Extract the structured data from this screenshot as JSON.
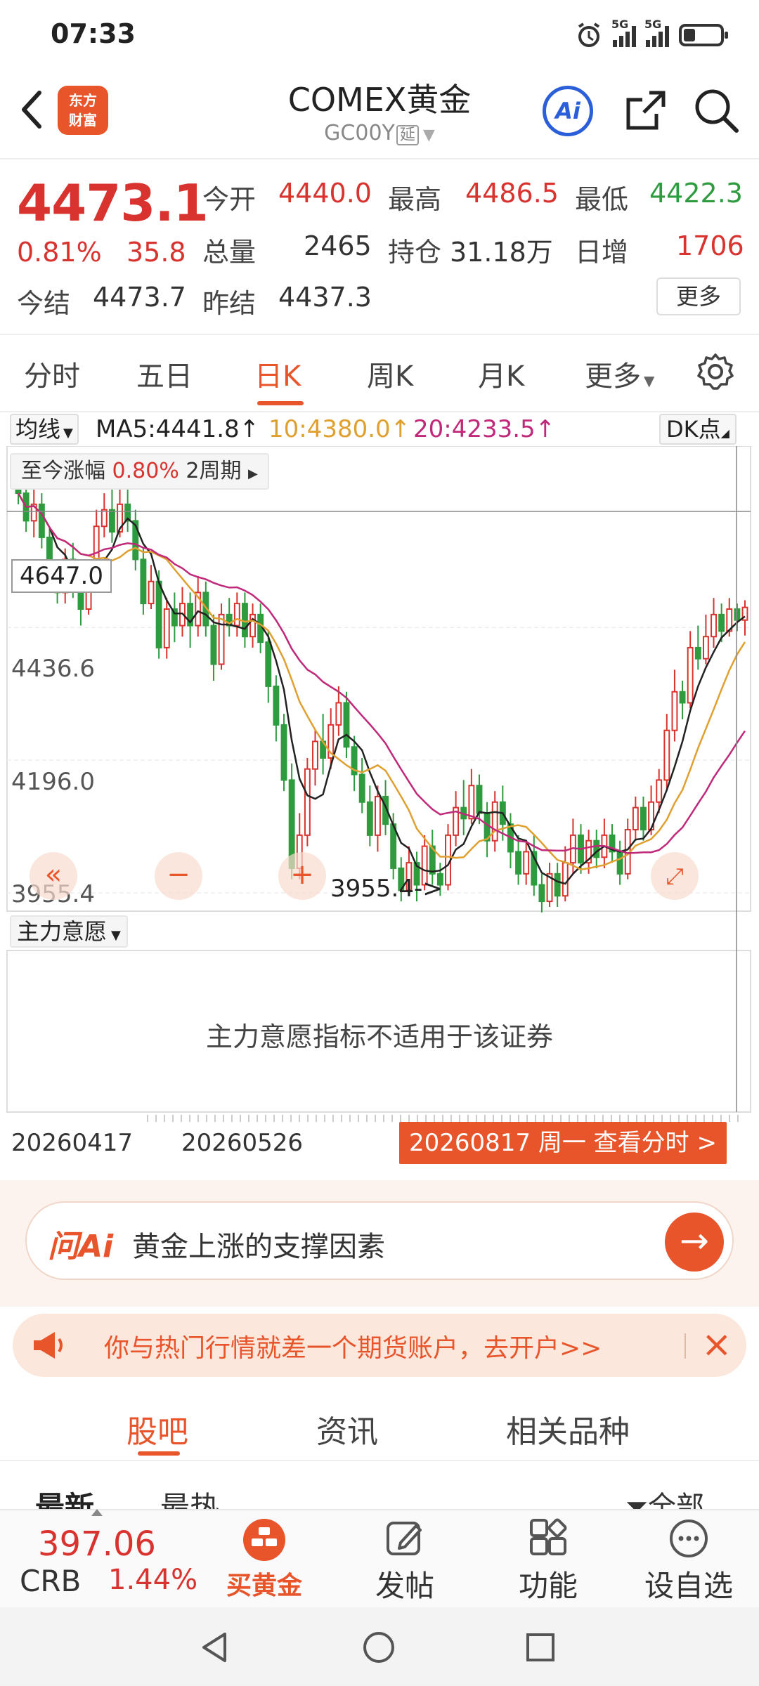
{
  "status_bar": {
    "time": "07:33",
    "sig1": "5G",
    "sig2": "5G"
  },
  "header": {
    "logo_line1": "东方",
    "logo_line2": "财富",
    "title": "COMEX黄金",
    "subtitle": "GC00Y",
    "delay_tag": "延",
    "ai_label": "Ai"
  },
  "quote": {
    "price": "4473.1",
    "change_pct": "0.81%",
    "change_val": "35.8",
    "open_label": "今开",
    "open": "4440.0",
    "high_label": "最高",
    "high": "4486.5",
    "low_label": "最低",
    "low": "4422.3",
    "volume_label": "总量",
    "volume": "2465",
    "oi_label": "持仓",
    "oi": "31.18万",
    "daily_inc_label": "日增",
    "daily_inc": "1706",
    "settle_label": "今结",
    "settle": "4473.7",
    "prev_settle_label": "昨结",
    "prev_settle": "4437.3",
    "more": "更多"
  },
  "period_tabs": [
    "分时",
    "五日",
    "日K",
    "周K",
    "月K",
    "更多"
  ],
  "active_period": "日K",
  "ma_row": {
    "select": "均线",
    "ma5": "MA5:4441.8↑",
    "ma10": "10:4380.0↑",
    "ma20": "20:4233.5↑",
    "dk": "DK点"
  },
  "colors": {
    "accent": "#e8552b",
    "up": "#d8332f",
    "down": "#2e9b3e",
    "ma5": "#222222",
    "ma10": "#e0a030",
    "ma20": "#c0287a"
  },
  "chart_data": {
    "type": "candlestick",
    "range_label": "至今涨幅",
    "range_pct": "0.80%",
    "range_period": "2周期",
    "cursor_value": "4647.0",
    "y_ticks": [
      "4436.6",
      "4196.0",
      "3955.4"
    ],
    "y_range": [
      3955.4,
      4740
    ],
    "min_label": "3955.4->",
    "x_ticks": [
      "20260417",
      "20260526"
    ],
    "selected_date": "20260817 周一 查看分时 >",
    "candles": [
      [
        4720,
        4680,
        4740,
        4660
      ],
      [
        4680,
        4630,
        4700,
        4610
      ],
      [
        4630,
        4660,
        4690,
        4600
      ],
      [
        4660,
        4600,
        4680,
        4580
      ],
      [
        4600,
        4520,
        4620,
        4500
      ],
      [
        4520,
        4500,
        4560,
        4480
      ],
      [
        4500,
        4560,
        4580,
        4480
      ],
      [
        4560,
        4510,
        4590,
        4490
      ],
      [
        4510,
        4470,
        4530,
        4440
      ],
      [
        4470,
        4540,
        4560,
        4460
      ],
      [
        4540,
        4620,
        4650,
        4530
      ],
      [
        4620,
        4650,
        4680,
        4600
      ],
      [
        4650,
        4610,
        4690,
        4590
      ],
      [
        4610,
        4660,
        4700,
        4600
      ],
      [
        4660,
        4630,
        4710,
        4610
      ],
      [
        4630,
        4560,
        4650,
        4540
      ],
      [
        4560,
        4480,
        4580,
        4460
      ],
      [
        4480,
        4520,
        4550,
        4470
      ],
      [
        4520,
        4400,
        4540,
        4380
      ],
      [
        4400,
        4470,
        4490,
        4380
      ],
      [
        4470,
        4440,
        4500,
        4410
      ],
      [
        4440,
        4480,
        4510,
        4420
      ],
      [
        4480,
        4440,
        4500,
        4400
      ],
      [
        4440,
        4500,
        4530,
        4420
      ],
      [
        4500,
        4440,
        4520,
        4420
      ],
      [
        4440,
        4370,
        4460,
        4340
      ],
      [
        4370,
        4460,
        4480,
        4360
      ],
      [
        4460,
        4440,
        4490,
        4420
      ],
      [
        4440,
        4480,
        4500,
        4420
      ],
      [
        4480,
        4420,
        4500,
        4400
      ],
      [
        4420,
        4460,
        4480,
        4400
      ],
      [
        4460,
        4410,
        4480,
        4390
      ],
      [
        4410,
        4330,
        4430,
        4300
      ],
      [
        4330,
        4260,
        4350,
        4230
      ],
      [
        4260,
        4160,
        4280,
        4140
      ],
      [
        4160,
        4000,
        4190,
        3980
      ],
      [
        4000,
        4060,
        4100,
        3980
      ],
      [
        4060,
        4180,
        4200,
        4040
      ],
      [
        4180,
        4230,
        4250,
        4150
      ],
      [
        4230,
        4200,
        4280,
        4170
      ],
      [
        4200,
        4260,
        4290,
        4180
      ],
      [
        4260,
        4300,
        4330,
        4240
      ],
      [
        4300,
        4220,
        4320,
        4200
      ],
      [
        4220,
        4170,
        4240,
        4140
      ],
      [
        4170,
        4120,
        4200,
        4100
      ],
      [
        4120,
        4060,
        4150,
        4040
      ],
      [
        4060,
        4130,
        4150,
        4030
      ],
      [
        4130,
        4080,
        4160,
        4060
      ],
      [
        4080,
        4000,
        4100,
        3980
      ],
      [
        4000,
        3960,
        4020,
        3940
      ],
      [
        3960,
        4010,
        4040,
        3950
      ],
      [
        4010,
        3970,
        4030,
        3940
      ],
      [
        3970,
        4040,
        4060,
        3960
      ],
      [
        4040,
        3990,
        4070,
        3970
      ],
      [
        3990,
        3970,
        4010,
        3950
      ],
      [
        3970,
        4060,
        4080,
        3960
      ],
      [
        4060,
        4110,
        4140,
        4040
      ],
      [
        4110,
        4090,
        4160,
        4060
      ],
      [
        4090,
        4150,
        4180,
        4080
      ],
      [
        4150,
        4100,
        4170,
        4080
      ],
      [
        4100,
        4050,
        4120,
        4020
      ],
      [
        4050,
        4120,
        4140,
        4030
      ],
      [
        4120,
        4080,
        4150,
        4050
      ],
      [
        4080,
        4030,
        4100,
        4000
      ],
      [
        4030,
        3990,
        4060,
        3970
      ],
      [
        3990,
        4030,
        4050,
        3970
      ],
      [
        4030,
        3970,
        4060,
        3950
      ],
      [
        3970,
        3940,
        3990,
        3920
      ],
      [
        3940,
        3990,
        4010,
        3930
      ],
      [
        3990,
        3950,
        4010,
        3930
      ],
      [
        3950,
        4010,
        4040,
        3940
      ],
      [
        4010,
        4060,
        4090,
        3990
      ],
      [
        4060,
        4010,
        4080,
        3990
      ],
      [
        4010,
        4050,
        4070,
        3990
      ],
      [
        4050,
        4020,
        4070,
        4000
      ],
      [
        4020,
        4060,
        4090,
        4000
      ],
      [
        4060,
        4030,
        4080,
        4010
      ],
      [
        4030,
        3990,
        4050,
        3970
      ],
      [
        3990,
        4070,
        4090,
        3980
      ],
      [
        4070,
        4110,
        4130,
        4050
      ],
      [
        4110,
        4070,
        4130,
        4050
      ],
      [
        4070,
        4120,
        4150,
        4060
      ],
      [
        4120,
        4160,
        4180,
        4100
      ],
      [
        4160,
        4250,
        4280,
        4140
      ],
      [
        4250,
        4320,
        4360,
        4230
      ],
      [
        4320,
        4300,
        4340,
        4270
      ],
      [
        4300,
        4400,
        4430,
        4290
      ],
      [
        4400,
        4380,
        4440,
        4360
      ],
      [
        4380,
        4420,
        4460,
        4370
      ],
      [
        4420,
        4460,
        4490,
        4400
      ],
      [
        4460,
        4430,
        4480,
        4410
      ],
      [
        4430,
        4470,
        4490,
        4420
      ],
      [
        4470,
        4450,
        4480,
        4430
      ],
      [
        4450,
        4473,
        4486,
        4422
      ]
    ]
  },
  "indicator": {
    "select": "主力意愿",
    "message": "主力意愿指标不适用于该证券"
  },
  "ai_ask": {
    "logo": "问Ai",
    "text": "黄金上涨的支撑因素"
  },
  "promo": {
    "text": "你与热门行情就差一个期货账户，去开户>>"
  },
  "forum_tabs": [
    "股吧",
    "资讯",
    "相关品种"
  ],
  "sort_row": {
    "latest": "最新",
    "hot": "最热",
    "filter": "全部"
  },
  "bottom_nav": {
    "crb_price": "397.06",
    "crb_name": "CRB",
    "crb_pct": "1.44%",
    "buy_gold": "买黄金",
    "post": "发帖",
    "function": "功能",
    "watchlist": "设自选"
  }
}
